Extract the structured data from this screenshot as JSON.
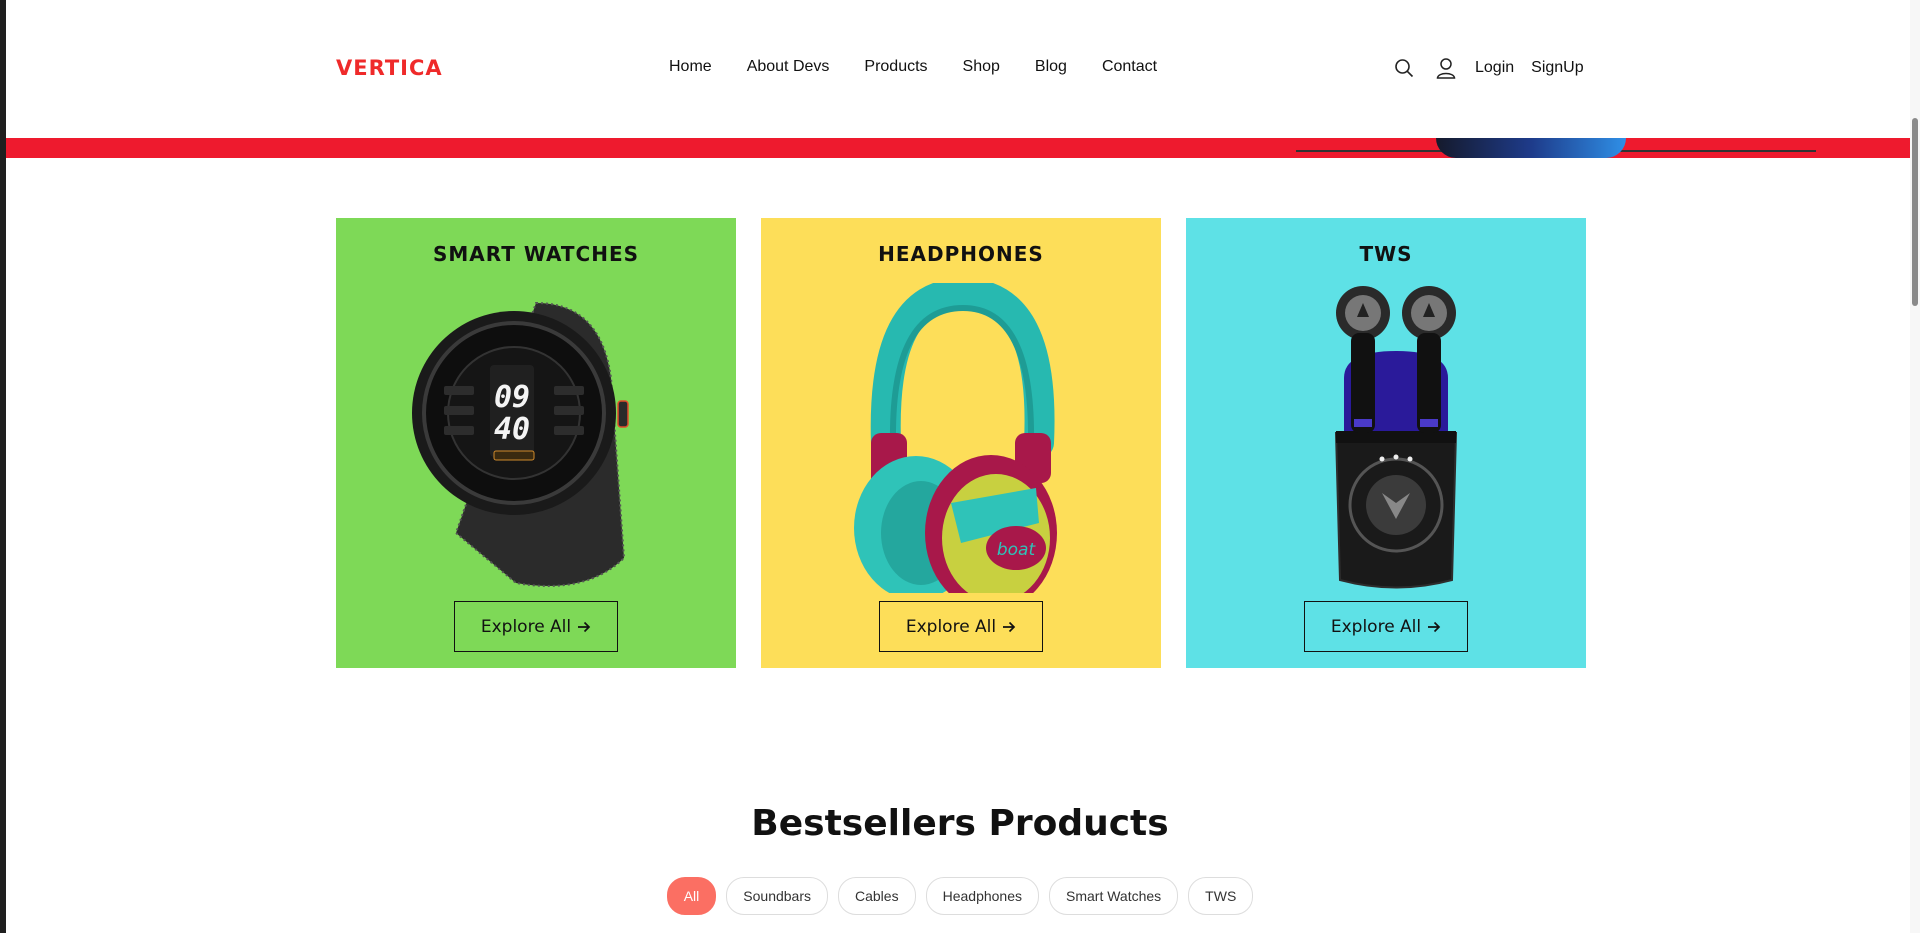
{
  "brand": {
    "logo": "VERTICA",
    "accent": "#ef2a2a"
  },
  "nav": {
    "links": [
      "Home",
      "About Devs",
      "Products",
      "Shop",
      "Blog",
      "Contact"
    ],
    "icons": [
      "search-icon",
      "user-icon"
    ],
    "login": "Login",
    "signup": "SignUp"
  },
  "categories": [
    {
      "title": "SMART WATCHES",
      "bg": "#7ed957",
      "button": "Explore All",
      "image": "smartwatch-image"
    },
    {
      "title": "HEADPHONES",
      "bg": "#fdde59",
      "button": "Explore All",
      "image": "headphones-image"
    },
    {
      "title": "TWS",
      "bg": "#5ee1e6",
      "button": "Explore All",
      "image": "tws-earbuds-image"
    }
  ],
  "watch_face": {
    "hour": "09",
    "minute": "40"
  },
  "headphone_brand": "boat",
  "bestsellers": {
    "title": "Bestsellers Products",
    "filters": [
      "All",
      "Soundbars",
      "Cables",
      "Headphones",
      "Smart Watches",
      "TWS"
    ],
    "active_filter": "All",
    "active_color": "#fb6f63"
  }
}
